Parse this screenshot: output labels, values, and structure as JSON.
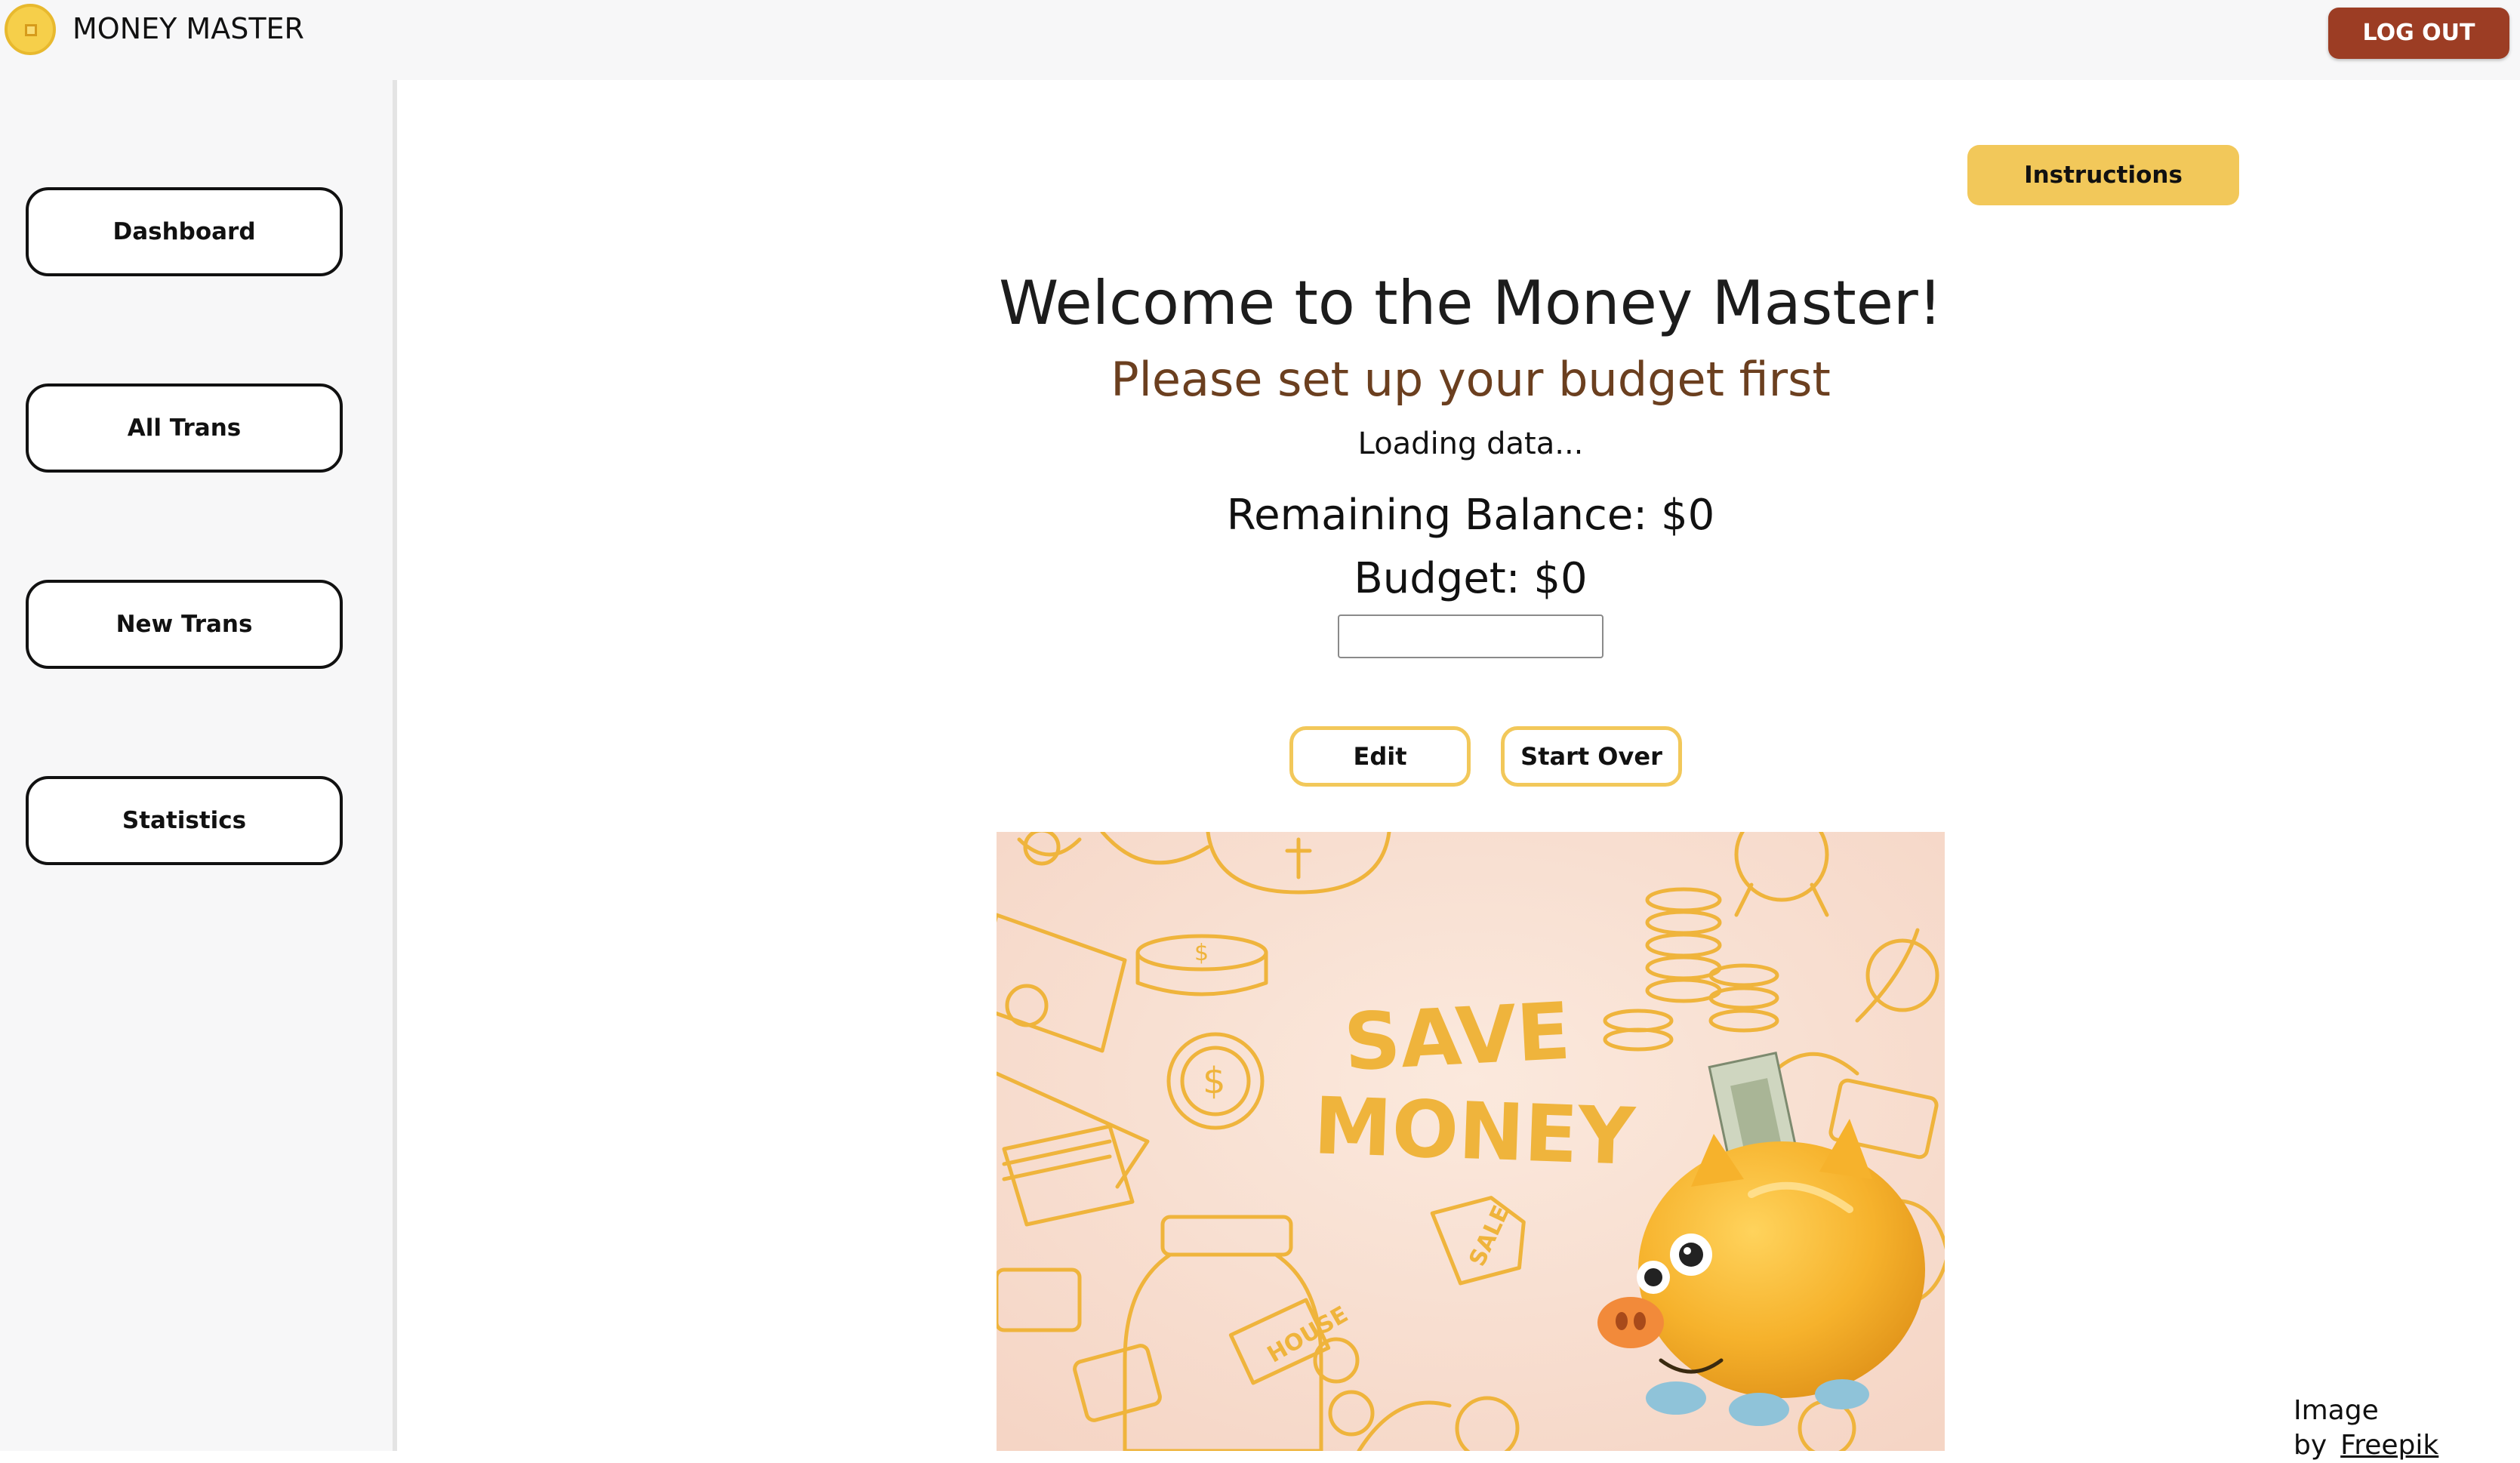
{
  "header": {
    "app_title": "MONEY MASTER",
    "logout_label": "LOG OUT",
    "logout_color": "#9c3d24"
  },
  "sidebar": {
    "items": [
      {
        "label": "Dashboard"
      },
      {
        "label": "All Trans"
      },
      {
        "label": "New Trans"
      },
      {
        "label": "Statistics"
      }
    ]
  },
  "main": {
    "instructions_label": "Instructions",
    "welcome": "Welcome to the Money Master!",
    "subtitle": "Please set up your budget first",
    "loading": "Loading data...",
    "remaining_balance": "Remaining Balance: $0",
    "budget": "Budget: $0",
    "budget_input_value": "",
    "edit_label": "Edit",
    "start_over_label": "Start Over",
    "accent_color": "#f2c85a"
  },
  "illustration": {
    "headline_line1": "SAVE",
    "headline_line2": "MONEY",
    "jar_label": "HOUSE",
    "tag_label": "SALE",
    "coin_symbol": "$"
  },
  "footer": {
    "credit_prefix": "Image by",
    "credit_link": "Freepik"
  }
}
